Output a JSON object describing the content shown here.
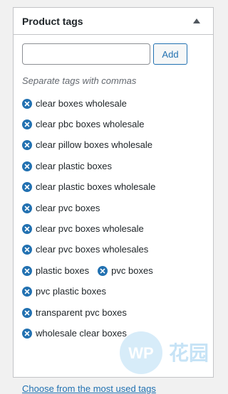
{
  "box": {
    "title": "Product tags"
  },
  "input": {
    "value": "",
    "placeholder": ""
  },
  "add_button": "Add",
  "hint": "Separate tags with commas",
  "tags": [
    {
      "label": "clear boxes wholesale"
    },
    {
      "label": "clear pbc boxes wholesale"
    },
    {
      "label": "clear pillow boxes wholesale"
    },
    {
      "label": "clear plastic boxes"
    },
    {
      "label": "clear plastic boxes wholesale"
    },
    {
      "label": "clear pvc boxes"
    },
    {
      "label": "clear pvc boxes wholesale"
    },
    {
      "label": "clear pvc boxes wholesales"
    },
    {
      "label": "plastic boxes"
    },
    {
      "label": "pvc boxes"
    },
    {
      "label": "pvc plastic boxes"
    },
    {
      "label": "transparent pvc boxes"
    },
    {
      "label": "wholesale clear boxes"
    }
  ],
  "choose_link": "Choose from the most used tags",
  "watermark_text": "WP 花园",
  "colors": {
    "accent": "#2271b1",
    "border": "#c3c4c7",
    "background": "#f1f1f1",
    "text": "#1d2327",
    "hint": "#646970"
  },
  "icons": {
    "toggle": "triangle-up-icon",
    "remove": "remove-tag-icon"
  }
}
